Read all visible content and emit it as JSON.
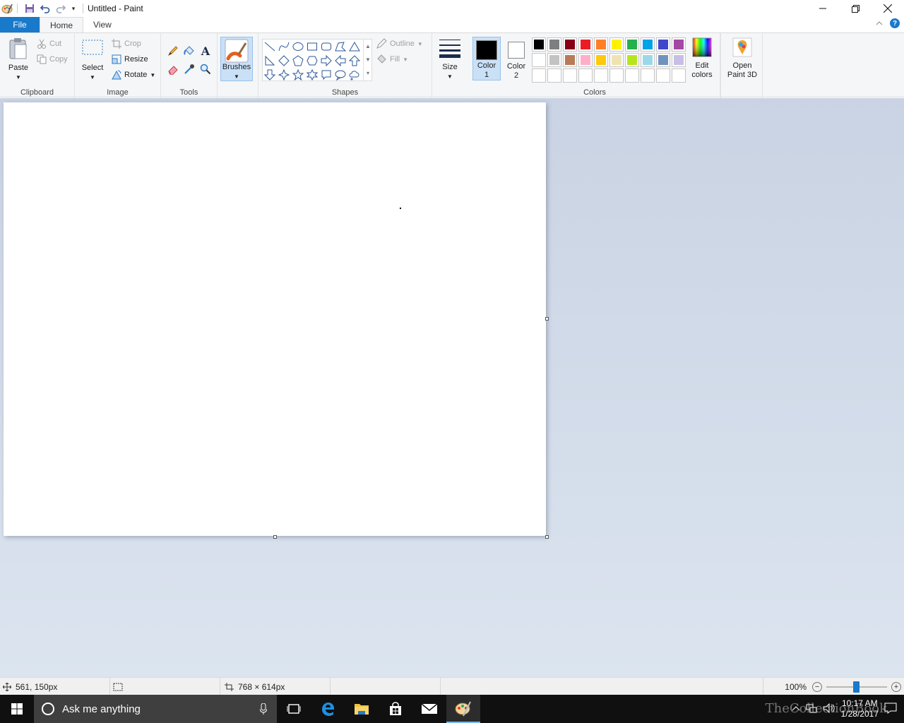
{
  "window": {
    "title": "Untitled - Paint"
  },
  "tabs": {
    "file": "File",
    "home": "Home",
    "view": "View"
  },
  "ribbon": {
    "clipboard": {
      "label": "Clipboard",
      "paste": "Paste",
      "cut": "Cut",
      "copy": "Copy"
    },
    "image": {
      "label": "Image",
      "select": "Select",
      "crop": "Crop",
      "resize": "Resize",
      "rotate": "Rotate"
    },
    "tools": {
      "label": "Tools"
    },
    "brushes": "Brushes",
    "shapes": {
      "label": "Shapes",
      "outline": "Outline",
      "fill": "Fill"
    },
    "size": "Size",
    "colors": {
      "label": "Colors",
      "color1_line1": "Color",
      "color1_line2": "1",
      "color2_line1": "Color",
      "color2_line2": "2",
      "edit_line1": "Edit",
      "edit_line2": "colors",
      "color1": "#000000",
      "color2": "#ffffff",
      "palette_row1": [
        "#000000",
        "#7f7f7f",
        "#880015",
        "#ed1c24",
        "#ff7f27",
        "#fff200",
        "#22b14c",
        "#00a2e8",
        "#3f48cc",
        "#a349a4"
      ],
      "palette_row2": [
        "#ffffff",
        "#c3c3c3",
        "#b97a57",
        "#ffaec9",
        "#ffc90e",
        "#efe4b0",
        "#b5e61d",
        "#99d9ea",
        "#7092be",
        "#c8bfe7"
      ]
    },
    "paint3d_line1": "Open",
    "paint3d_line2": "Paint 3D"
  },
  "status": {
    "cursor_pos": "561, 150px",
    "canvas_size": "768 × 614px",
    "zoom": "100%"
  },
  "taskbar": {
    "search_placeholder": "Ask me anything",
    "time": "10:17 AM",
    "date": "1/28/2017"
  },
  "watermark": "TheCollectionBook"
}
